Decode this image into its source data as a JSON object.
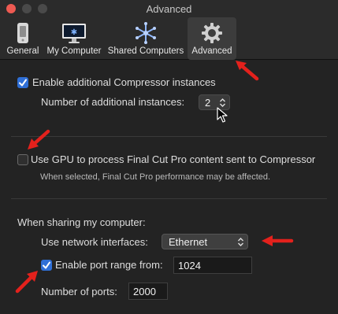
{
  "window": {
    "title": "Advanced"
  },
  "toolbar": {
    "tabs": [
      {
        "label": "General",
        "icon": "phone-icon"
      },
      {
        "label": "My Computer",
        "icon": "monitor-icon"
      },
      {
        "label": "Shared Computers",
        "icon": "network-icon"
      },
      {
        "label": "Advanced",
        "icon": "gear-icon",
        "active": true
      }
    ]
  },
  "instances": {
    "enable_label": "Enable additional Compressor instances",
    "enabled": true,
    "count_label": "Number of additional instances:",
    "count_value": "2"
  },
  "gpu": {
    "label": "Use GPU to process Final Cut Pro content sent to Compressor",
    "enabled": false,
    "note": "When selected, Final Cut Pro performance may be affected."
  },
  "sharing": {
    "heading": "When sharing my computer:",
    "interfaces_label": "Use network interfaces:",
    "interfaces_value": "Ethernet",
    "port_range_label": "Enable port range from:",
    "port_range_enabled": true,
    "port_from_value": "1024",
    "ports_label": "Number of ports:",
    "ports_value": "2000"
  },
  "colors": {
    "accent": "#2f6fd6",
    "annotation_arrow": "#e3211c"
  }
}
